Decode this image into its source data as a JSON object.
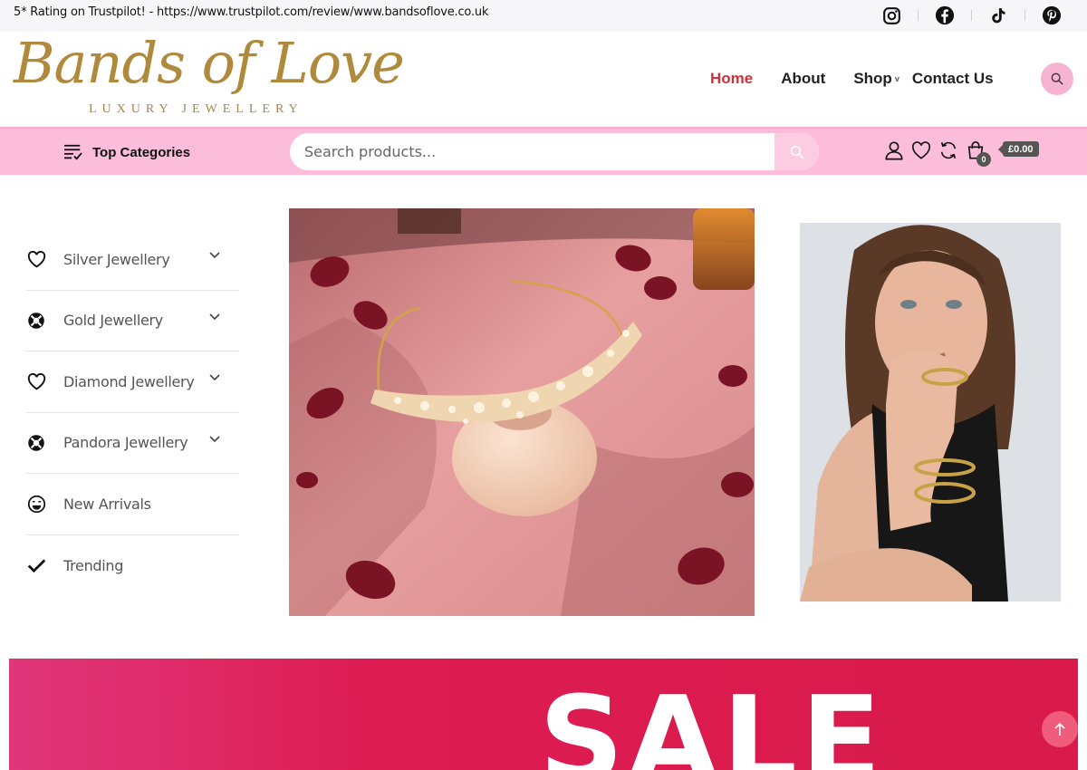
{
  "topbar": {
    "promo_text": "5* Rating on Trustpilot! - https://www.trustpilot.com/review/www.bandsoflove.co.uk",
    "social_icons": [
      "instagram-icon",
      "facebook-icon",
      "tiktok-icon",
      "pinterest-icon"
    ]
  },
  "header": {
    "logo_script": "Bands of Love",
    "logo_tagline": "LUXURY JEWELLERY",
    "nav": {
      "home": "Home",
      "about": "About",
      "shop": "Shop",
      "shop_caret": "v",
      "contact": "Contact Us"
    }
  },
  "toolbar": {
    "top_categories": "Top Categories",
    "search_placeholder": "Search products...",
    "cart_count": "0",
    "cart_total": "£0.00"
  },
  "categories": [
    {
      "label": "Silver Jewellery",
      "icon": "heart-icon",
      "has_submenu": true
    },
    {
      "label": "Gold Jewellery",
      "icon": "lifebuoy-icon",
      "has_submenu": true
    },
    {
      "label": "Diamond Jewellery",
      "icon": "heart-icon",
      "has_submenu": true
    },
    {
      "label": "Pandora Jewellery",
      "icon": "lifebuoy-icon",
      "has_submenu": true
    },
    {
      "label": "New Arrivals",
      "icon": "smile-icon",
      "has_submenu": false
    },
    {
      "label": "Trending",
      "icon": "check-icon",
      "has_submenu": false
    }
  ],
  "banner": {
    "sale_text": "SALE"
  },
  "colors": {
    "accent_pink": "#fbbdd9",
    "nav_active": "#d42f3b",
    "logo_gold": "#b08a3c",
    "sale_red": "#dd1c52"
  }
}
